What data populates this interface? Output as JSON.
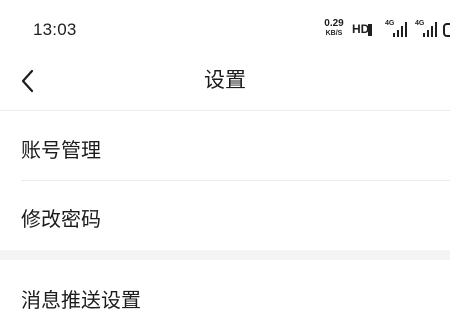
{
  "status_bar": {
    "time": "13:03",
    "net_speed_value": "0.29",
    "net_speed_unit": "KB/S",
    "hd_label": "HD",
    "signal1_label": "4G",
    "signal2_label": "4G"
  },
  "header": {
    "title": "设置",
    "back_icon": "chevron-left-icon"
  },
  "settings": {
    "items": [
      {
        "label": "账号管理"
      },
      {
        "label": "修改密码"
      },
      {
        "label": "消息推送设置"
      }
    ]
  }
}
